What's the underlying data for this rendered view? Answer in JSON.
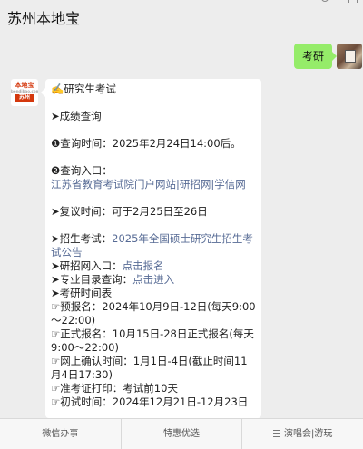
{
  "header": {
    "title": "苏州本地宝"
  },
  "me": {
    "message": "考研"
  },
  "bot": {
    "avatar_name": "本地宝",
    "avatar_city": "苏州",
    "avatar_sub": "bendibao.com"
  },
  "content": {
    "title": "✍️研究生考试",
    "score_head": "➤成绩查询",
    "query_time": "❶查询时间：2025年2月24日14:00后。",
    "query_entry": "❷查询入口：",
    "query_links": "江苏省教育考试院门户网站|研招网|学信网",
    "recheck": "➤复议时间：可于2月25日至26日",
    "enroll_prefix": "➤招生考试：",
    "enroll_link": "2025年全国硕士研究生招生考试公告",
    "yzw_prefix": "➤研招网入口：",
    "yzw_link": "点击报名",
    "catalog_prefix": "➤专业目录查询：",
    "catalog_link": "点击进入",
    "schedule_head": "➤考研时间表",
    "pre_reg": "☞预报名：2024年10月9日-12日(每天9:00～22:00)",
    "formal_reg": "☞正式报名：10月15日-28日正式报名(每天9:00～22:00)",
    "online_confirm": "☞网上确认时间：1月1日-4日(截止时间11月4日17:30)",
    "admission_ticket": "☞准考证打印：考试前10天",
    "exam_time": "☞初试时间：2024年12月21日-12月23日"
  },
  "bottom_tabs": [
    {
      "label": "微信办事"
    },
    {
      "label": "特惠优选"
    },
    {
      "label": "演唱会|游玩"
    }
  ]
}
